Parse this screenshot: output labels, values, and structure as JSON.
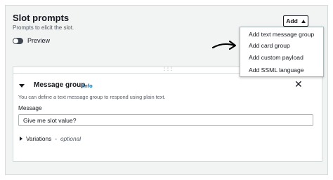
{
  "section": {
    "title": "Slot prompts",
    "subtitle": "Prompts to elicit the slot."
  },
  "preview": {
    "label": "Preview",
    "enabled": false
  },
  "add_menu": {
    "button_label": "Add",
    "items": [
      "Add text message group",
      "Add card group",
      "Add custom payload",
      "Add SSML language"
    ]
  },
  "message_group": {
    "title": "Message group",
    "info_link": "Info",
    "description": "You can define a text message group to respond using plain text.",
    "message_label": "Message",
    "message_value": "Give me slot value?",
    "variations_label": "Variations",
    "variations_separator": "-",
    "variations_optional": "optional"
  },
  "icons": {
    "close": "close-icon",
    "drag": "drag-handle-icon",
    "caret_up": "caret-up-icon",
    "caret_down": "caret-down-icon",
    "caret_right": "caret-right-icon",
    "hand_arrow": "hand-drawn-arrow-annotation"
  },
  "colors": {
    "panel_bg": "#f2f3f3",
    "link_blue": "#0073bb",
    "text": "#16191f",
    "secondary_text": "#545b64",
    "border": "#d5dbdb"
  }
}
